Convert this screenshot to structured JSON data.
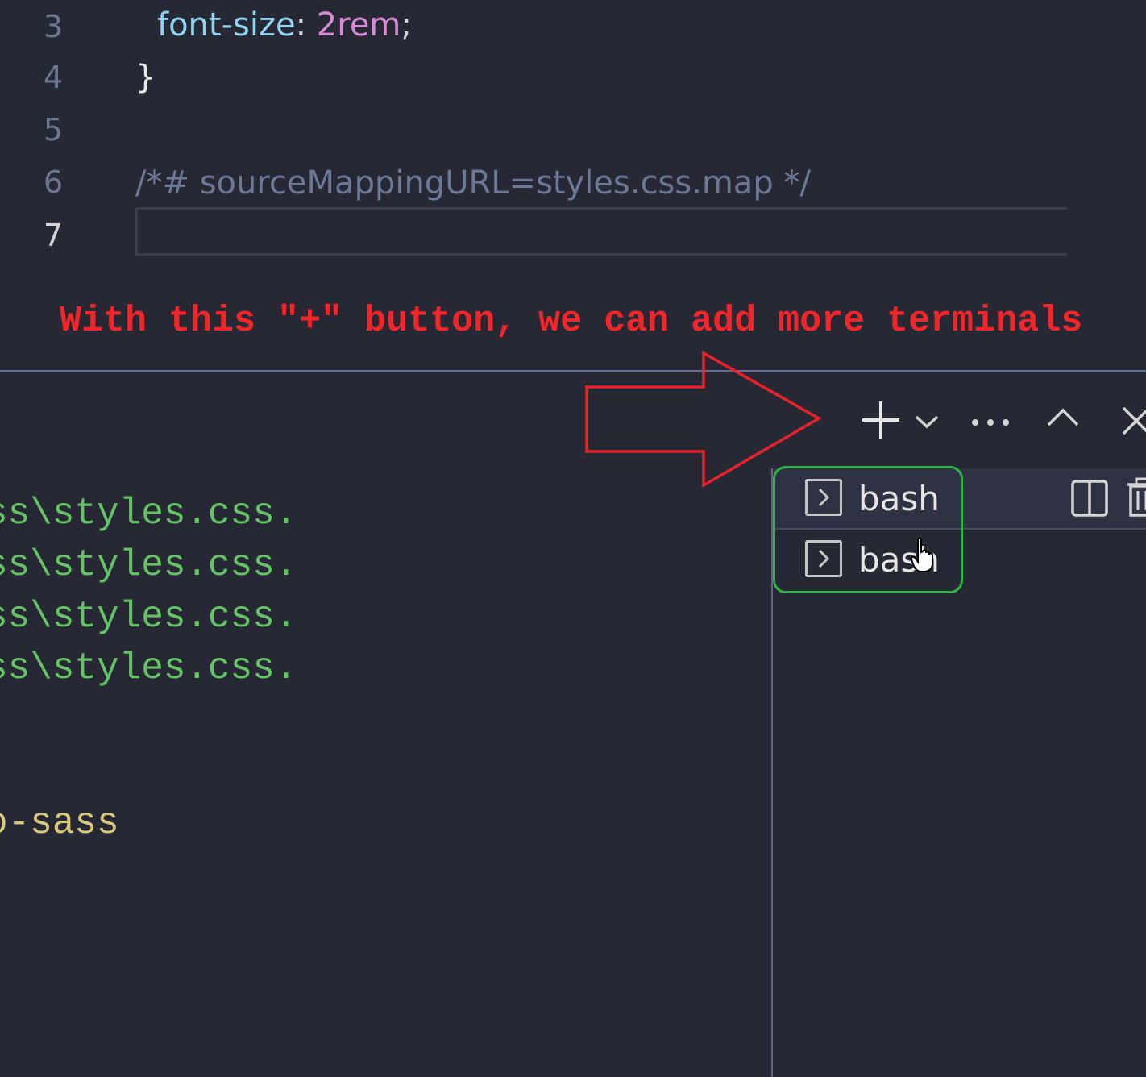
{
  "editor": {
    "line_numbers": [
      "3",
      "4",
      "5",
      "6",
      "7"
    ],
    "lines": {
      "l3": {
        "prop": "font-size",
        "colon": ":",
        "space": " ",
        "value": "2rem",
        "semi": ";"
      },
      "l4": {
        "brace": "}"
      },
      "l6": {
        "comment": "/*# sourceMappingURL=styles.css.map */"
      }
    }
  },
  "annotation": {
    "text": "With this \"+\" button, we can add more terminals",
    "arrow_color": "#e8222a"
  },
  "terminal": {
    "output_lines": [
      "ss\\styles.css.",
      "ss\\styles.css.",
      "ss\\styles.css.",
      "ss\\styles.css."
    ],
    "last_line": "o-sass"
  },
  "toolbar": {
    "icons": [
      "plus-icon",
      "chevron-down-icon",
      "more-icon",
      "chevron-up-icon",
      "close-icon"
    ]
  },
  "tabs": [
    {
      "label": "bash",
      "icon": "terminal-icon",
      "selected": true
    },
    {
      "label": "bash",
      "icon": "terminal-icon",
      "selected": false
    }
  ],
  "tab_actions": [
    "split-icon",
    "trash-icon"
  ],
  "colors": {
    "highlight": "#2fb34a",
    "annotation": "#f0262b"
  }
}
